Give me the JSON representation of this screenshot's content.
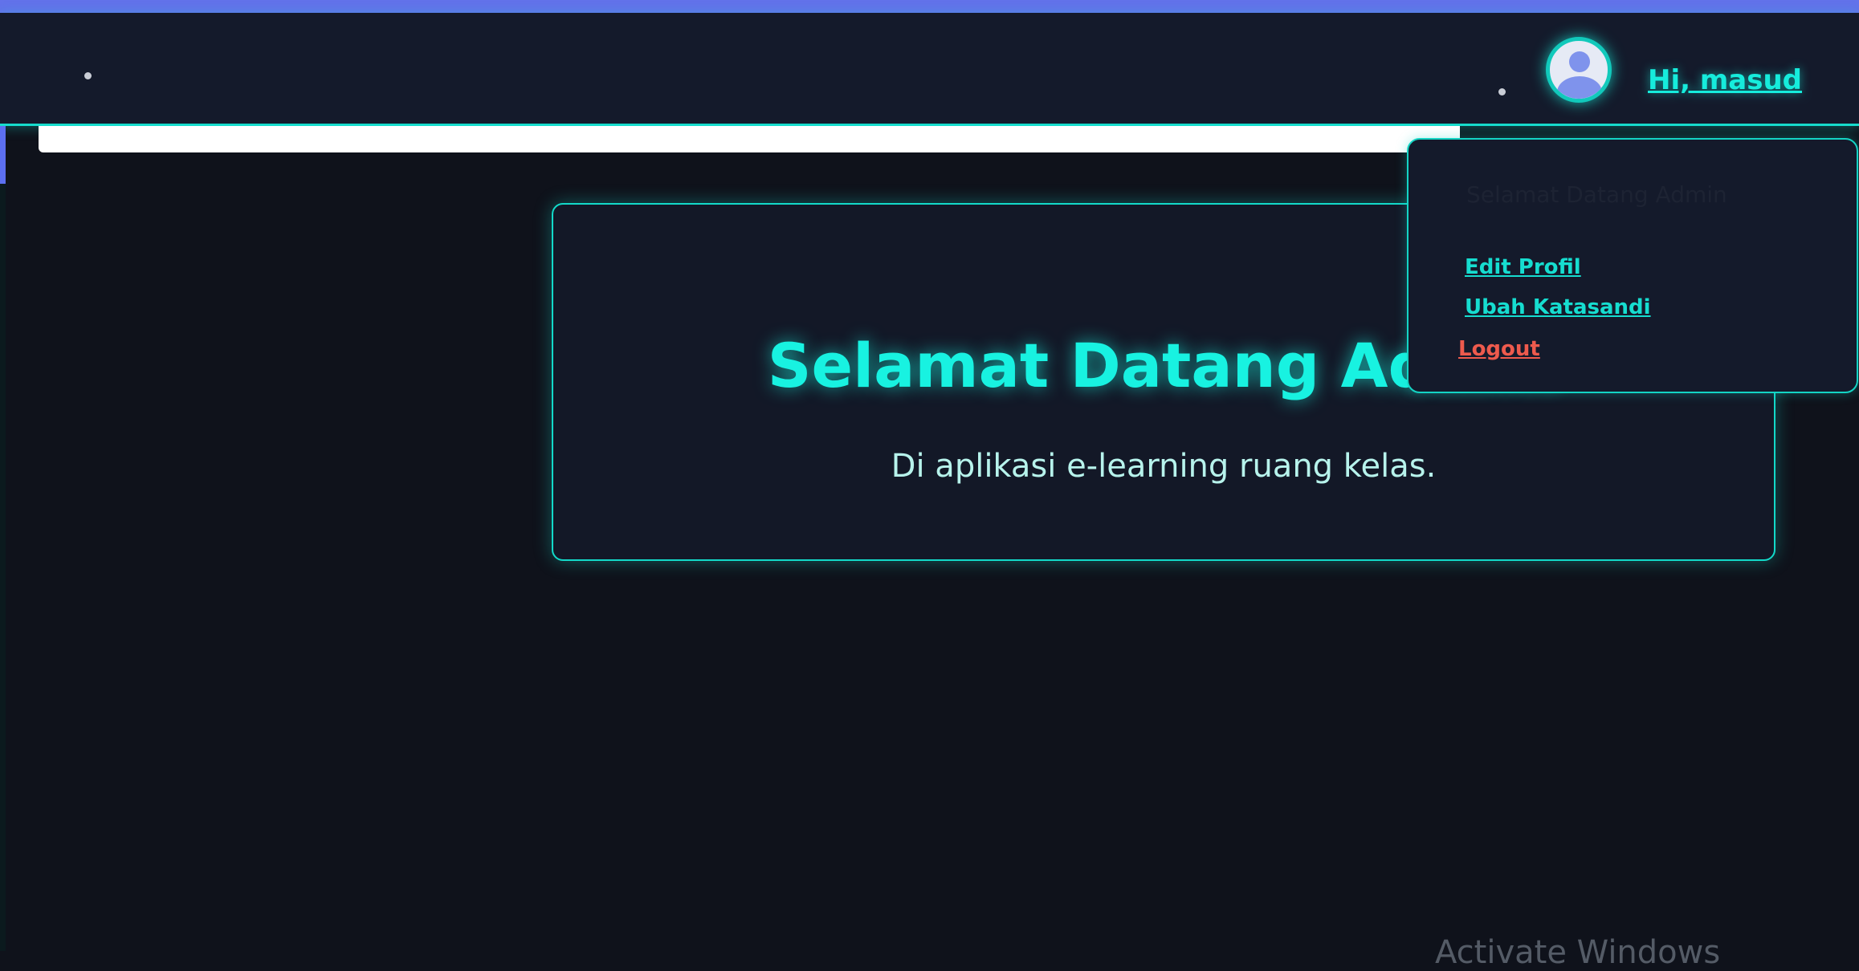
{
  "header": {
    "greeting": "Hi, masud"
  },
  "hero": {
    "title": "Selamat Datang Admin",
    "subtitle": "Di aplikasi e-learning ruang kelas."
  },
  "profile_menu": {
    "header": "Selamat Datang Admin",
    "items": [
      {
        "label": "Edit Profil"
      },
      {
        "label": "Ubah Katasandi"
      },
      {
        "label": "Logout"
      }
    ]
  },
  "watermark": "Activate Windows",
  "icons": {
    "avatar": "user-avatar-icon"
  },
  "colors": {
    "accent": "#16ecdc",
    "topbar": "#6272ea",
    "background": "#0f121b",
    "logout": "#ee5a4d"
  }
}
